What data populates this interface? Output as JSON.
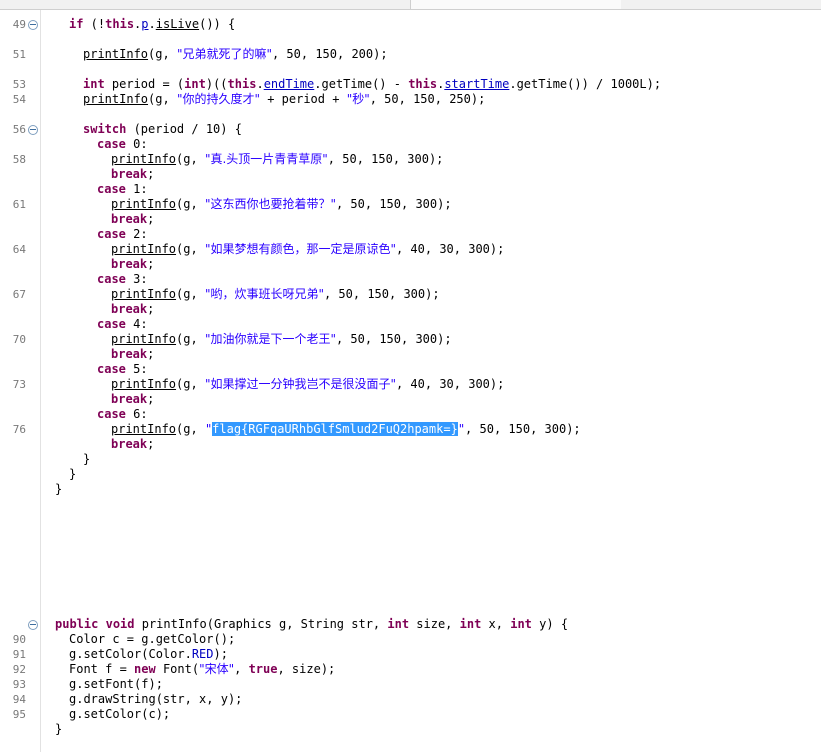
{
  "editor": {
    "lines": [
      {
        "num": "49",
        "fold": true,
        "indent": 1,
        "segs": [
          {
            "t": "if",
            "c": "kw"
          },
          {
            "t": " (!"
          },
          {
            "t": "this",
            "c": "kw"
          },
          {
            "t": "."
          },
          {
            "t": "p",
            "c": "fld u"
          },
          {
            "t": "."
          },
          {
            "t": "isLive",
            "c": "u"
          },
          {
            "t": "()) {"
          }
        ]
      },
      {
        "blank": true
      },
      {
        "num": "51",
        "indent": 2,
        "segs": [
          {
            "t": "printInfo",
            "c": "u"
          },
          {
            "t": "(g, "
          },
          {
            "t": "\"兄弟就死了的嘛\"",
            "c": "str"
          },
          {
            "t": ", 50, 150, 200);"
          }
        ]
      },
      {
        "blank": true
      },
      {
        "num": "53",
        "indent": 2,
        "segs": [
          {
            "t": "int",
            "c": "kw"
          },
          {
            "t": " period = ("
          },
          {
            "t": "int",
            "c": "kw"
          },
          {
            "t": ")(("
          },
          {
            "t": "this",
            "c": "kw"
          },
          {
            "t": "."
          },
          {
            "t": "endTime",
            "c": "fld u"
          },
          {
            "t": ".getTime() - "
          },
          {
            "t": "this",
            "c": "kw"
          },
          {
            "t": "."
          },
          {
            "t": "startTime",
            "c": "fld u"
          },
          {
            "t": ".getTime()) / 1000L);"
          }
        ]
      },
      {
        "num": "54",
        "indent": 2,
        "segs": [
          {
            "t": "printInfo",
            "c": "u"
          },
          {
            "t": "(g, "
          },
          {
            "t": "\"你的持久度才\"",
            "c": "str"
          },
          {
            "t": " + period + "
          },
          {
            "t": "\"秒\"",
            "c": "str"
          },
          {
            "t": ", 50, 150, 250);"
          }
        ]
      },
      {
        "blank": true
      },
      {
        "num": "56",
        "fold": true,
        "indent": 2,
        "segs": [
          {
            "t": "switch",
            "c": "kw"
          },
          {
            "t": " (period / 10) {"
          }
        ]
      },
      {
        "indent": 3,
        "segs": [
          {
            "t": "case",
            "c": "kw"
          },
          {
            "t": " 0:"
          }
        ]
      },
      {
        "num": "58",
        "indent": 4,
        "segs": [
          {
            "t": "printInfo",
            "c": "u"
          },
          {
            "t": "(g, "
          },
          {
            "t": "\"真.头顶一片青青草原\"",
            "c": "str"
          },
          {
            "t": ", 50, 150, 300);"
          }
        ]
      },
      {
        "indent": 4,
        "segs": [
          {
            "t": "break",
            "c": "kw"
          },
          {
            "t": ";"
          }
        ]
      },
      {
        "indent": 3,
        "segs": [
          {
            "t": "case",
            "c": "kw"
          },
          {
            "t": " 1:"
          }
        ]
      },
      {
        "num": "61",
        "indent": 4,
        "segs": [
          {
            "t": "printInfo",
            "c": "u"
          },
          {
            "t": "(g, "
          },
          {
            "t": "\"这东西你也要抢着带？\"",
            "c": "str"
          },
          {
            "t": ", 50, 150, 300);"
          }
        ]
      },
      {
        "indent": 4,
        "segs": [
          {
            "t": "break",
            "c": "kw"
          },
          {
            "t": ";"
          }
        ]
      },
      {
        "indent": 3,
        "segs": [
          {
            "t": "case",
            "c": "kw"
          },
          {
            "t": " 2:"
          }
        ]
      },
      {
        "num": "64",
        "indent": 4,
        "segs": [
          {
            "t": "printInfo",
            "c": "u"
          },
          {
            "t": "(g, "
          },
          {
            "t": "\"如果梦想有颜色，那一定是原谅色\"",
            "c": "str"
          },
          {
            "t": ", 40, 30, 300);"
          }
        ]
      },
      {
        "indent": 4,
        "segs": [
          {
            "t": "break",
            "c": "kw"
          },
          {
            "t": ";"
          }
        ]
      },
      {
        "indent": 3,
        "segs": [
          {
            "t": "case",
            "c": "kw"
          },
          {
            "t": " 3:"
          }
        ]
      },
      {
        "num": "67",
        "indent": 4,
        "segs": [
          {
            "t": "printInfo",
            "c": "u"
          },
          {
            "t": "(g, "
          },
          {
            "t": "\"哟，炊事班长呀兄弟\"",
            "c": "str"
          },
          {
            "t": ", 50, 150, 300);"
          }
        ]
      },
      {
        "indent": 4,
        "segs": [
          {
            "t": "break",
            "c": "kw"
          },
          {
            "t": ";"
          }
        ]
      },
      {
        "indent": 3,
        "segs": [
          {
            "t": "case",
            "c": "kw"
          },
          {
            "t": " 4:"
          }
        ]
      },
      {
        "num": "70",
        "indent": 4,
        "segs": [
          {
            "t": "printInfo",
            "c": "u"
          },
          {
            "t": "(g, "
          },
          {
            "t": "\"加油你就是下一个老王\"",
            "c": "str"
          },
          {
            "t": ", 50, 150, 300);"
          }
        ]
      },
      {
        "indent": 4,
        "segs": [
          {
            "t": "break",
            "c": "kw"
          },
          {
            "t": ";"
          }
        ]
      },
      {
        "indent": 3,
        "segs": [
          {
            "t": "case",
            "c": "kw"
          },
          {
            "t": " 5:"
          }
        ]
      },
      {
        "num": "73",
        "indent": 4,
        "segs": [
          {
            "t": "printInfo",
            "c": "u"
          },
          {
            "t": "(g, "
          },
          {
            "t": "\"如果撑过一分钟我岂不是很没面子\"",
            "c": "str"
          },
          {
            "t": ", 40, 30, 300);"
          }
        ]
      },
      {
        "indent": 4,
        "segs": [
          {
            "t": "break",
            "c": "kw"
          },
          {
            "t": ";"
          }
        ]
      },
      {
        "indent": 3,
        "segs": [
          {
            "t": "case",
            "c": "kw"
          },
          {
            "t": " 6:"
          }
        ]
      },
      {
        "num": "76",
        "indent": 4,
        "segs": [
          {
            "t": "printInfo",
            "c": "u"
          },
          {
            "t": "(g, "
          },
          {
            "t": "\"",
            "c": "str"
          },
          {
            "t": "flag{RGFqaURhbGlfSmlud2FuQ2hpamk=}",
            "c": "str sel"
          },
          {
            "t": "\"",
            "c": "str"
          },
          {
            "t": ", 50, 150, 300);"
          }
        ]
      },
      {
        "indent": 4,
        "segs": [
          {
            "t": "break",
            "c": "kw"
          },
          {
            "t": ";"
          }
        ]
      },
      {
        "indent": 2,
        "segs": [
          {
            "t": "}"
          }
        ]
      },
      {
        "indent": 1,
        "segs": [
          {
            "t": "}"
          }
        ]
      },
      {
        "indent": 0,
        "segs": [
          {
            "t": "}"
          }
        ]
      }
    ],
    "lines2": [
      {
        "fold": true,
        "indent": 0,
        "segs": [
          {
            "t": "public",
            "c": "kw"
          },
          {
            "t": " "
          },
          {
            "t": "void",
            "c": "kw"
          },
          {
            "t": " printInfo(Graphics g, String str, "
          },
          {
            "t": "int",
            "c": "kw"
          },
          {
            "t": " size, "
          },
          {
            "t": "int",
            "c": "kw"
          },
          {
            "t": " x, "
          },
          {
            "t": "int",
            "c": "kw"
          },
          {
            "t": " y) {"
          }
        ]
      },
      {
        "num": "90",
        "indent": 1,
        "segs": [
          {
            "t": "Color c = g.getColor();"
          }
        ]
      },
      {
        "num": "91",
        "indent": 1,
        "segs": [
          {
            "t": "g.setColor(Color."
          },
          {
            "t": "RED",
            "c": "fld"
          },
          {
            "t": ");"
          }
        ]
      },
      {
        "num": "92",
        "indent": 1,
        "segs": [
          {
            "t": "Font f = "
          },
          {
            "t": "new",
            "c": "kw"
          },
          {
            "t": " Font("
          },
          {
            "t": "\"宋体\"",
            "c": "str"
          },
          {
            "t": ", "
          },
          {
            "t": "true",
            "c": "kw"
          },
          {
            "t": ", size);"
          }
        ]
      },
      {
        "num": "93",
        "indent": 1,
        "segs": [
          {
            "t": "g.setFont(f);"
          }
        ]
      },
      {
        "num": "94",
        "indent": 1,
        "segs": [
          {
            "t": "g.drawString(str, x, y);"
          }
        ]
      },
      {
        "num": "95",
        "indent": 1,
        "segs": [
          {
            "t": "g.setColor(c);"
          }
        ]
      },
      {
        "indent": 0,
        "segs": [
          {
            "t": "}"
          }
        ]
      }
    ]
  }
}
